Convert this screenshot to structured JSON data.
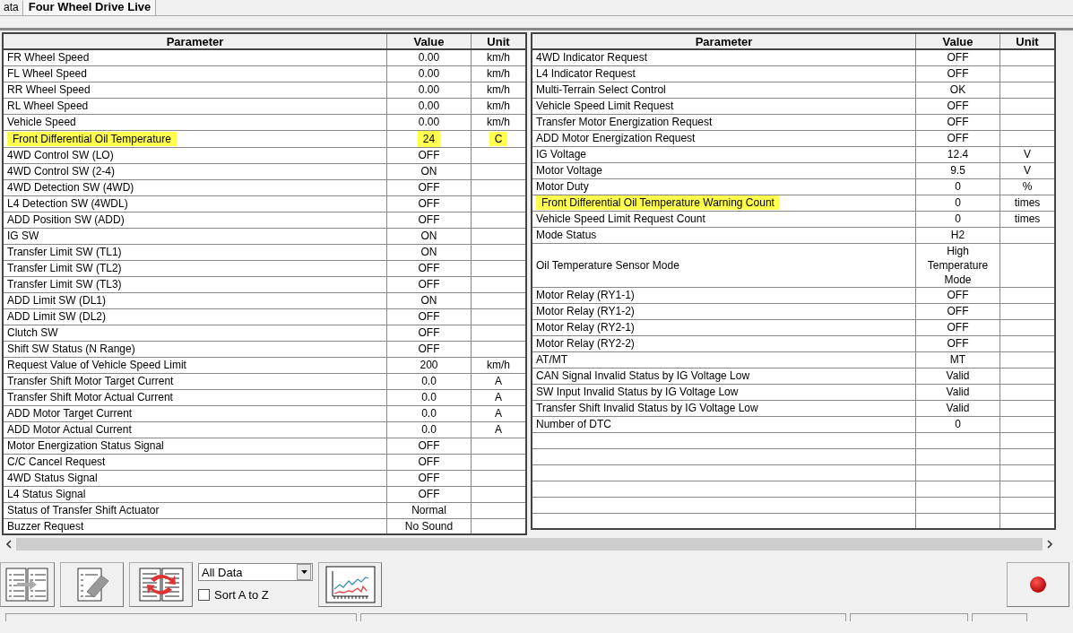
{
  "tabs": [
    {
      "label": "ata",
      "selected": false
    },
    {
      "label": "Four Wheel Drive Live",
      "selected": true
    }
  ],
  "tables": [
    {
      "columns": [
        "Parameter",
        "Value",
        "Unit"
      ],
      "rows": [
        {
          "parameter": "FR Wheel Speed",
          "value": "0.00",
          "unit": "km/h",
          "parameter_highlighted": false,
          "value_highlighted": false,
          "unit_highlighted": false
        },
        {
          "parameter": "FL Wheel Speed",
          "value": "0.00",
          "unit": "km/h",
          "parameter_highlighted": false,
          "value_highlighted": false,
          "unit_highlighted": false
        },
        {
          "parameter": "RR Wheel Speed",
          "value": "0.00",
          "unit": "km/h",
          "parameter_highlighted": false,
          "value_highlighted": false,
          "unit_highlighted": false
        },
        {
          "parameter": "RL Wheel Speed",
          "value": "0.00",
          "unit": "km/h",
          "parameter_highlighted": false,
          "value_highlighted": false,
          "unit_highlighted": false
        },
        {
          "parameter": "Vehicle Speed",
          "value": "0.00",
          "unit": "km/h",
          "parameter_highlighted": false,
          "value_highlighted": false,
          "unit_highlighted": false
        },
        {
          "parameter": "Front Differential Oil Temperature",
          "value": "24",
          "unit": "C",
          "parameter_highlighted": true,
          "value_highlighted": true,
          "unit_highlighted": true
        },
        {
          "parameter": "4WD Control SW (LO)",
          "value": "OFF",
          "parameter_highlighted": false,
          "value_highlighted": false
        },
        {
          "parameter": "4WD Control SW (2-4)",
          "value": "ON",
          "parameter_highlighted": false,
          "value_highlighted": false
        },
        {
          "parameter": "4WD Detection SW (4WD)",
          "value": "OFF",
          "parameter_highlighted": false,
          "value_highlighted": false
        },
        {
          "parameter": "L4 Detection SW (4WDL)",
          "value": "OFF",
          "parameter_highlighted": false,
          "value_highlighted": false
        },
        {
          "parameter": "ADD Position SW (ADD)",
          "value": "OFF",
          "parameter_highlighted": false,
          "value_highlighted": false
        },
        {
          "parameter": "IG SW",
          "value": "ON",
          "parameter_highlighted": false,
          "value_highlighted": false
        },
        {
          "parameter": "Transfer Limit SW (TL1)",
          "value": "ON",
          "parameter_highlighted": false,
          "value_highlighted": false
        },
        {
          "parameter": "Transfer Limit SW (TL2)",
          "value": "OFF",
          "parameter_highlighted": false,
          "value_highlighted": false
        },
        {
          "parameter": "Transfer Limit SW (TL3)",
          "value": "OFF",
          "parameter_highlighted": false,
          "value_highlighted": false
        },
        {
          "parameter": "ADD Limit SW (DL1)",
          "value": "ON",
          "parameter_highlighted": false,
          "value_highlighted": false
        },
        {
          "parameter": "ADD Limit SW (DL2)",
          "value": "OFF",
          "parameter_highlighted": false,
          "value_highlighted": false
        },
        {
          "parameter": "Clutch SW",
          "value": "OFF",
          "parameter_highlighted": false,
          "value_highlighted": false
        },
        {
          "parameter": "Shift SW Status (N Range)",
          "value": "OFF",
          "parameter_highlighted": false,
          "value_highlighted": false
        },
        {
          "parameter": "Request Value of Vehicle Speed Limit",
          "value": "200",
          "unit": "km/h",
          "parameter_highlighted": false,
          "value_highlighted": false,
          "unit_highlighted": false
        },
        {
          "parameter": "Transfer Shift Motor Target Current",
          "value": "0.0",
          "unit": "A",
          "parameter_highlighted": false,
          "value_highlighted": false,
          "unit_highlighted": false
        },
        {
          "parameter": "Transfer Shift Motor Actual Current",
          "value": "0.0",
          "unit": "A",
          "parameter_highlighted": false,
          "value_highlighted": false,
          "unit_highlighted": false
        },
        {
          "parameter": "ADD Motor Target Current",
          "value": "0.0",
          "unit": "A",
          "parameter_highlighted": false,
          "value_highlighted": false,
          "unit_highlighted": false
        },
        {
          "parameter": "ADD Motor Actual Current",
          "value": "0.0",
          "unit": "A",
          "parameter_highlighted": false,
          "value_highlighted": false,
          "unit_highlighted": false
        },
        {
          "parameter": "Motor Energization Status Signal",
          "value": "OFF",
          "parameter_highlighted": false,
          "value_highlighted": false
        },
        {
          "parameter": "C/C Cancel Request",
          "value": "OFF",
          "parameter_highlighted": false,
          "value_highlighted": false
        },
        {
          "parameter": "4WD Status Signal",
          "value": "OFF",
          "parameter_highlighted": false,
          "value_highlighted": false
        },
        {
          "parameter": "L4 Status Signal",
          "value": "OFF",
          "parameter_highlighted": false,
          "value_highlighted": false
        },
        {
          "parameter": "Status of Transfer Shift Actuator",
          "value": "Normal",
          "parameter_highlighted": false,
          "value_highlighted": false
        },
        {
          "parameter": "Buzzer Request",
          "value": "No Sound",
          "parameter_highlighted": false,
          "value_highlighted": false
        }
      ]
    },
    {
      "columns": [
        "Parameter",
        "Value",
        "Unit"
      ],
      "rows": [
        {
          "parameter": "4WD Indicator Request",
          "value": "OFF",
          "parameter_highlighted": false,
          "value_highlighted": false
        },
        {
          "parameter": "L4 Indicator Request",
          "value": "OFF",
          "parameter_highlighted": false,
          "value_highlighted": false
        },
        {
          "parameter": "Multi-Terrain Select Control",
          "value": "OK",
          "parameter_highlighted": false,
          "value_highlighted": false
        },
        {
          "parameter": "Vehicle Speed Limit Request",
          "value": "OFF",
          "parameter_highlighted": false,
          "value_highlighted": false
        },
        {
          "parameter": "Transfer Motor Energization Request",
          "value": "OFF",
          "parameter_highlighted": false,
          "value_highlighted": false
        },
        {
          "parameter": "ADD Motor Energization Request",
          "value": "OFF",
          "parameter_highlighted": false,
          "value_highlighted": false
        },
        {
          "parameter": "IG Voltage",
          "value": "12.4",
          "unit": "V",
          "parameter_highlighted": false,
          "value_highlighted": false,
          "unit_highlighted": false
        },
        {
          "parameter": "Motor Voltage",
          "value": "9.5",
          "unit": "V",
          "parameter_highlighted": false,
          "value_highlighted": false,
          "unit_highlighted": false
        },
        {
          "parameter": "Motor Duty",
          "value": "0",
          "unit": "%",
          "parameter_highlighted": false,
          "value_highlighted": false,
          "unit_highlighted": false
        },
        {
          "parameter": "Front Differential Oil Temperature Warning Count",
          "value": "0",
          "unit": "times",
          "parameter_highlighted": true,
          "value_highlighted": false,
          "unit_highlighted": false
        },
        {
          "parameter": "Vehicle Speed Limit Request Count",
          "value": "0",
          "unit": "times",
          "parameter_highlighted": false,
          "value_highlighted": false,
          "unit_highlighted": false
        },
        {
          "parameter": "Mode Status",
          "value": "H2",
          "parameter_highlighted": false,
          "value_highlighted": false
        },
        {
          "parameter": "Oil Temperature Sensor  Mode",
          "value": "High Temperature Mode",
          "parameter_highlighted": false,
          "value_highlighted": false
        },
        {
          "parameter": "Motor Relay (RY1-1)",
          "value": "OFF",
          "parameter_highlighted": false,
          "value_highlighted": false
        },
        {
          "parameter": "Motor Relay (RY1-2)",
          "value": "OFF",
          "parameter_highlighted": false,
          "value_highlighted": false
        },
        {
          "parameter": "Motor Relay (RY2-1)",
          "value": "OFF",
          "parameter_highlighted": false,
          "value_highlighted": false
        },
        {
          "parameter": "Motor Relay (RY2-2)",
          "value": "OFF",
          "parameter_highlighted": false,
          "value_highlighted": false
        },
        {
          "parameter": "AT/MT",
          "value": "MT",
          "parameter_highlighted": false,
          "value_highlighted": false
        },
        {
          "parameter": "CAN Signal Invalid Status by IG Voltage Low",
          "value": "Valid",
          "parameter_highlighted": false,
          "value_highlighted": false
        },
        {
          "parameter": "SW Input Invalid Status by IG Voltage Low",
          "value": "Valid",
          "parameter_highlighted": false,
          "value_highlighted": false
        },
        {
          "parameter": "Transfer Shift Invalid Status by IG Voltage Low",
          "value": "Valid",
          "parameter_highlighted": false,
          "value_highlighted": false
        },
        {
          "parameter": "Number of DTC",
          "value": "0",
          "parameter_highlighted": false,
          "value_highlighted": false
        }
      ]
    }
  ],
  "toolbar": {
    "dropdown": {
      "value": "All Data"
    },
    "sort_checkbox": {
      "label": "Sort A to Z",
      "checked": false
    }
  }
}
